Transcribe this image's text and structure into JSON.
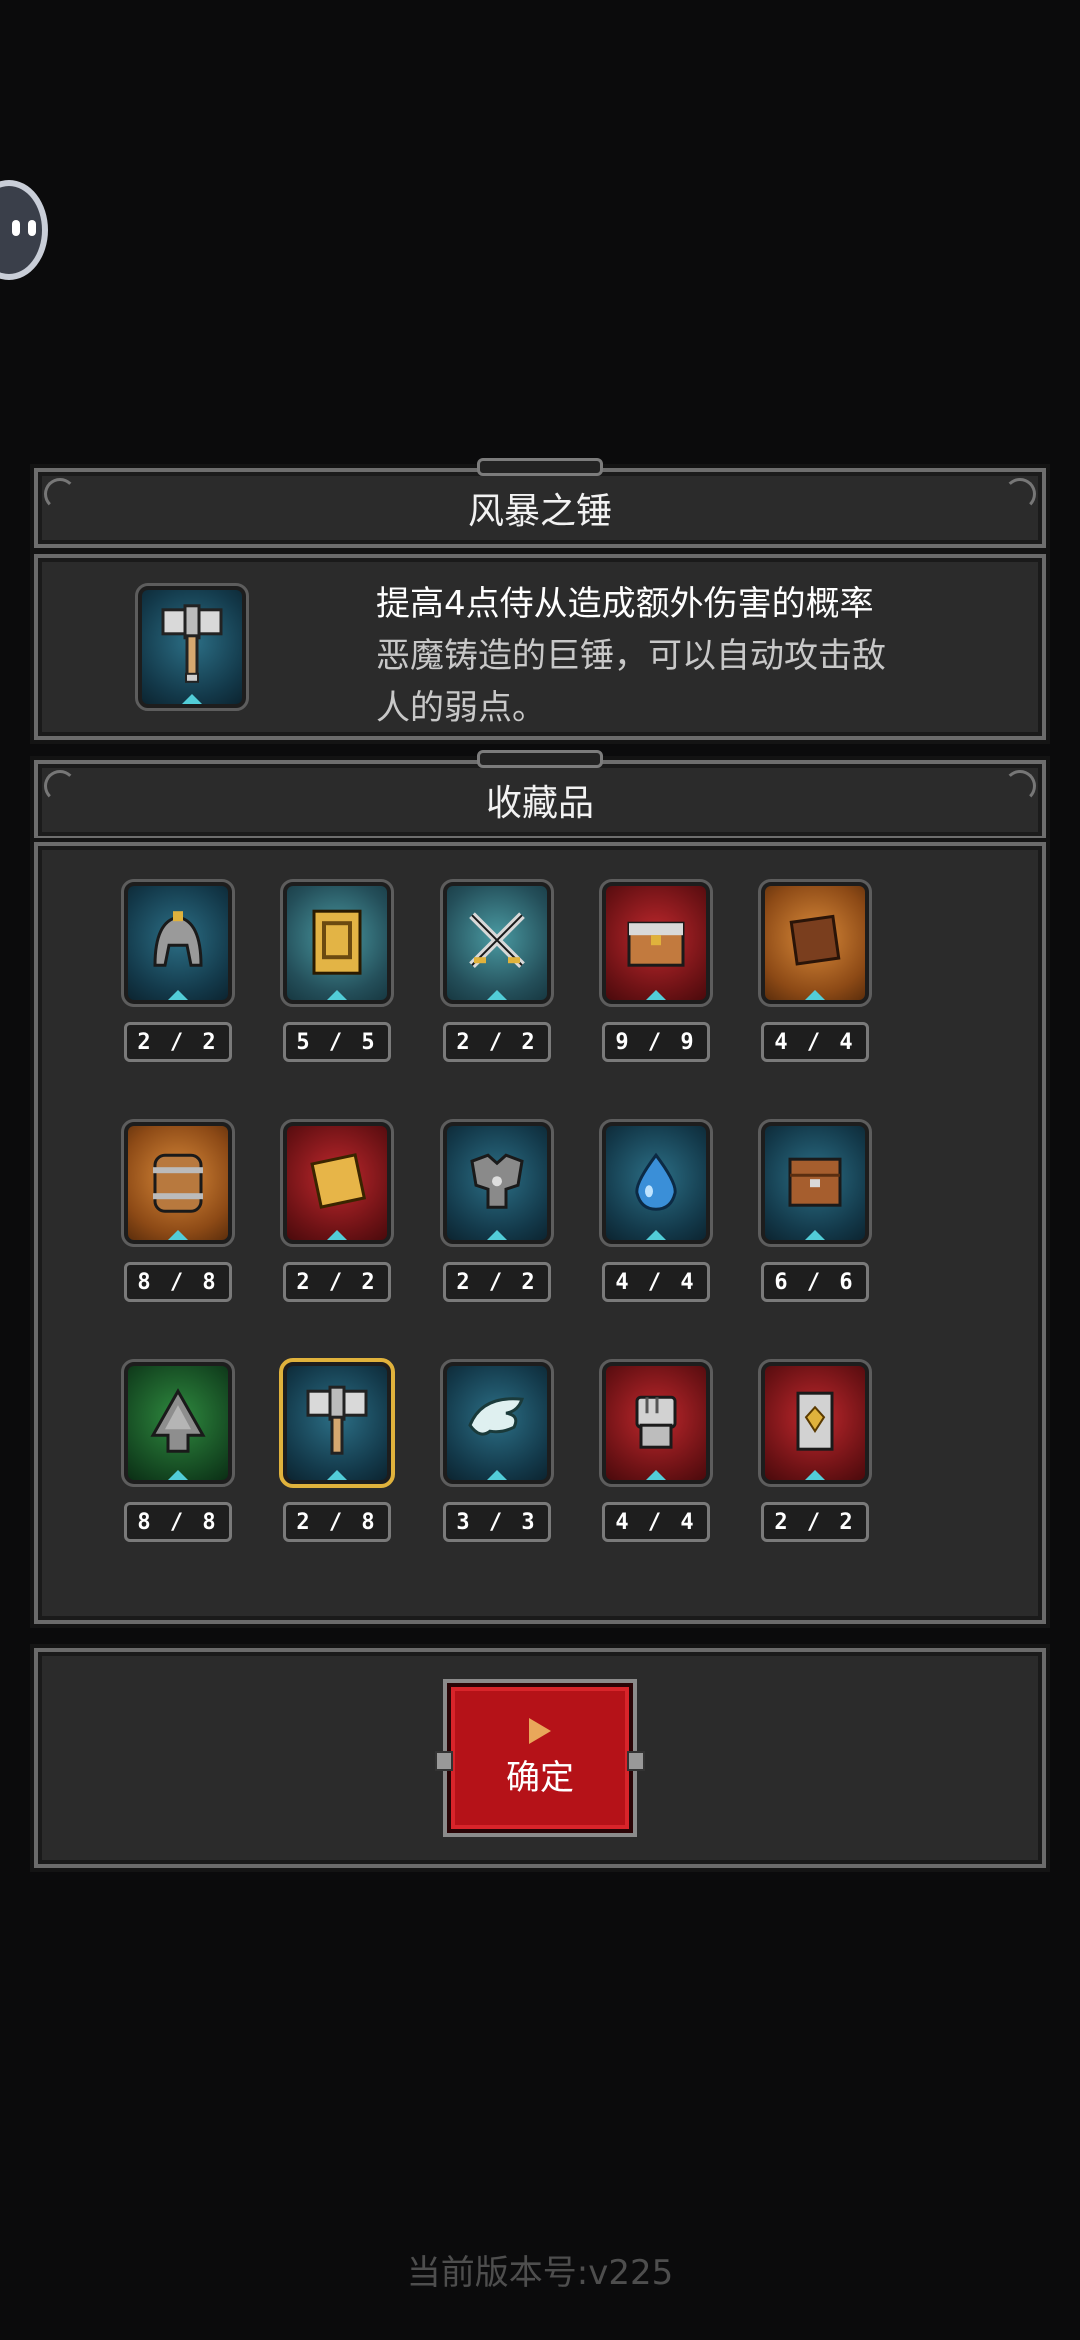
{
  "item_panel": {
    "title": "风暴之锤",
    "effect": "提高4点侍从造成额外伤害的概率",
    "description_line1": "恶魔铸造的巨锤，可以自动攻击敌",
    "description_line2": "人的弱点。",
    "icon": "hammer-icon"
  },
  "collection_panel": {
    "title": "收藏品",
    "items": [
      {
        "icon": "helmet-icon",
        "count": "2 / 2",
        "bg": "blue"
      },
      {
        "icon": "gold-card-icon",
        "count": "5 / 5",
        "bg": "teal"
      },
      {
        "icon": "crossed-swords-icon",
        "count": "2 / 2",
        "bg": "teal"
      },
      {
        "icon": "treasure-chest-icon",
        "count": "9 / 9",
        "bg": "red"
      },
      {
        "icon": "brown-tablet-icon",
        "count": "4 / 4",
        "bg": "orange"
      },
      {
        "icon": "barrel-icon",
        "count": "8 / 8",
        "bg": "orange"
      },
      {
        "icon": "scroll-icon",
        "count": "2 / 2",
        "bg": "red"
      },
      {
        "icon": "armor-icon",
        "count": "2 / 2",
        "bg": "blue"
      },
      {
        "icon": "water-drop-icon",
        "count": "4 / 4",
        "bg": "blue"
      },
      {
        "icon": "wooden-box-icon",
        "count": "6 / 6",
        "bg": "blue"
      },
      {
        "icon": "green-tree-icon",
        "count": "8 / 8",
        "bg": "green"
      },
      {
        "icon": "hammer-icon",
        "count": "2 / 8",
        "bg": "blue",
        "selected": true
      },
      {
        "icon": "wing-icon",
        "count": "3 / 3",
        "bg": "blue"
      },
      {
        "icon": "fist-icon",
        "count": "4 / 4",
        "bg": "red"
      },
      {
        "icon": "shield-gem-icon",
        "count": "2 / 2",
        "bg": "red"
      }
    ]
  },
  "confirm_button": {
    "label": "确定",
    "icon": "play-icon"
  },
  "version_text": "当前版本号:v225",
  "colors": {
    "accent_red": "#b51218",
    "gold_outline": "#e0b23c",
    "panel_bg": "#2b2b2b"
  }
}
